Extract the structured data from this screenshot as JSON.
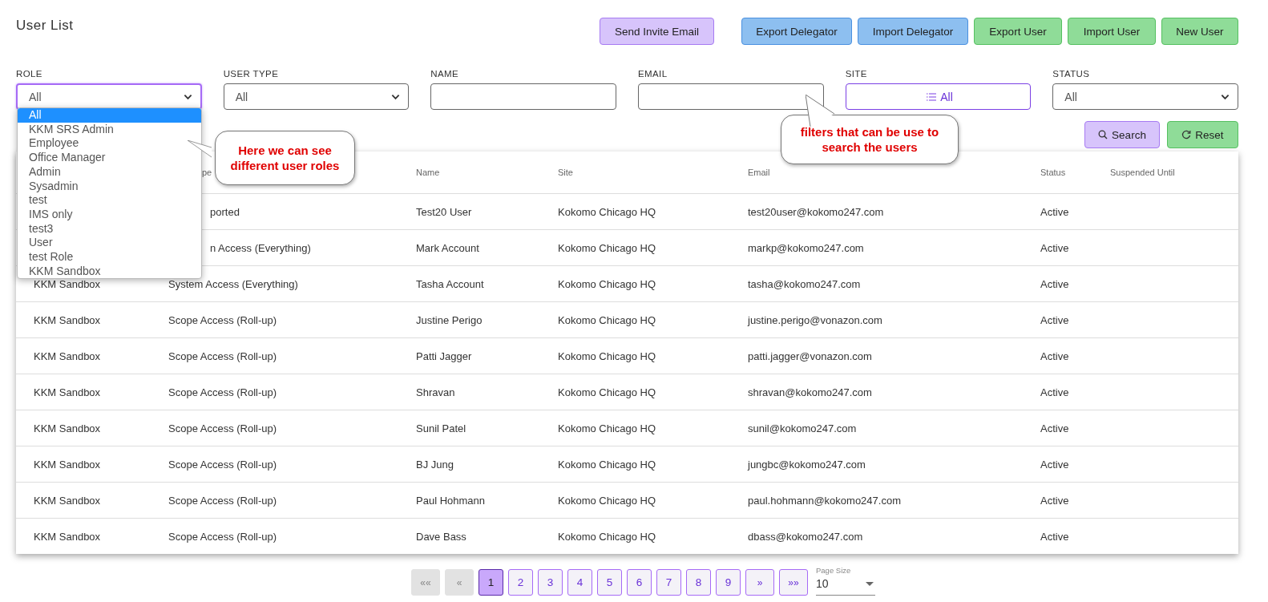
{
  "title": "User List",
  "top_buttons": [
    {
      "label": "Send Invite Email",
      "kind": "invite"
    },
    {
      "label": "Export Delegator",
      "kind": "delegator"
    },
    {
      "label": "Import Delegator",
      "kind": "delegator"
    },
    {
      "label": "Export User",
      "kind": "user"
    },
    {
      "label": "Import User",
      "kind": "user"
    },
    {
      "label": "New User",
      "kind": "user"
    }
  ],
  "filters": [
    {
      "label": "ROLE",
      "kind": "select",
      "value": "All",
      "focused": true
    },
    {
      "label": "USER TYPE",
      "kind": "select",
      "value": "All",
      "focused": false
    },
    {
      "label": "NAME",
      "kind": "text",
      "focused": false
    },
    {
      "label": "EMAIL",
      "kind": "text",
      "focused": false
    },
    {
      "label": "SITE",
      "kind": "multiselect",
      "value": "All",
      "focused": false
    },
    {
      "label": "STATUS",
      "kind": "select",
      "value": "All",
      "focused": false
    }
  ],
  "role_options": [
    {
      "label": "All",
      "selected": true
    },
    {
      "label": "KKM SRS Admin",
      "selected": false
    },
    {
      "label": "Employee",
      "selected": false
    },
    {
      "label": "Office Manager",
      "selected": false
    },
    {
      "label": "Admin",
      "selected": false
    },
    {
      "label": "Sysadmin",
      "selected": false
    },
    {
      "label": "test",
      "selected": false
    },
    {
      "label": "IMS only",
      "selected": false
    },
    {
      "label": "test3",
      "selected": false
    },
    {
      "label": "User",
      "selected": false
    },
    {
      "label": "test Role",
      "selected": false
    },
    {
      "label": "KKM Sandbox",
      "selected": false
    }
  ],
  "search_button": "Search",
  "reset_button": "Reset",
  "callouts": [
    {
      "text": "Here we can see different user roles"
    },
    {
      "text": "filters that can be use to search the users"
    }
  ],
  "table": {
    "header": {
      "user_type": "pe",
      "user_type_cut": true,
      "name": "Name",
      "site": "Site",
      "email": "Email",
      "status": "Status",
      "suspended": "Suspended Until"
    },
    "rows": [
      {
        "user_type": "ported",
        "user_type_cut": true,
        "name": "Test20 User",
        "site": "Kokomo Chicago HQ",
        "email": "test20user@kokomo247.com",
        "status": "Active"
      },
      {
        "user_type": "n Access (Everything)",
        "user_type_cut": true,
        "name": "Mark Account",
        "site": "Kokomo Chicago HQ",
        "email": "markp@kokomo247.com",
        "status": "Active"
      },
      {
        "role": "KKM Sandbox",
        "user_type": "System Access (Everything)",
        "name": "Tasha Account",
        "site": "Kokomo Chicago HQ",
        "email": "tasha@kokomo247.com",
        "status": "Active"
      },
      {
        "role": "KKM Sandbox",
        "user_type": "Scope Access (Roll-up)",
        "name": "Justine Perigo",
        "site": "Kokomo Chicago HQ",
        "email": "justine.perigo@vonazon.com",
        "status": "Active"
      },
      {
        "role": "KKM Sandbox",
        "user_type": "Scope Access (Roll-up)",
        "name": "Patti Jagger",
        "site": "Kokomo Chicago HQ",
        "email": "patti.jagger@vonazon.com",
        "status": "Active"
      },
      {
        "role": "KKM Sandbox",
        "user_type": "Scope Access (Roll-up)",
        "name": "Shravan",
        "site": "Kokomo Chicago HQ",
        "email": "shravan@kokomo247.com",
        "status": "Active"
      },
      {
        "role": "KKM Sandbox",
        "user_type": "Scope Access (Roll-up)",
        "name": "Sunil Patel",
        "site": "Kokomo Chicago HQ",
        "email": "sunil@kokomo247.com",
        "status": "Active"
      },
      {
        "role": "KKM Sandbox",
        "user_type": "Scope Access (Roll-up)",
        "name": "BJ Jung",
        "site": "Kokomo Chicago HQ",
        "email": "jungbc@kokomo247.com",
        "status": "Active"
      },
      {
        "role": "KKM Sandbox",
        "user_type": "Scope Access (Roll-up)",
        "name": "Paul Hohmann",
        "site": "Kokomo Chicago HQ",
        "email": "paul.hohmann@kokomo247.com",
        "status": "Active"
      },
      {
        "role": "KKM Sandbox",
        "user_type": "Scope Access (Roll-up)",
        "name": "Dave Bass",
        "site": "Kokomo Chicago HQ",
        "email": "dbass@kokomo247.com",
        "status": "Active"
      }
    ]
  },
  "pagination": [
    {
      "label": "««",
      "kind": "first",
      "disabled": true,
      "selected": false
    },
    {
      "label": "«",
      "kind": "prev",
      "disabled": true,
      "selected": false
    },
    {
      "label": "1",
      "kind": "page",
      "disabled": false,
      "selected": true
    },
    {
      "label": "2",
      "kind": "page",
      "disabled": false,
      "selected": false
    },
    {
      "label": "3",
      "kind": "page",
      "disabled": false,
      "selected": false
    },
    {
      "label": "4",
      "kind": "page",
      "disabled": false,
      "selected": false
    },
    {
      "label": "5",
      "kind": "page",
      "disabled": false,
      "selected": false
    },
    {
      "label": "6",
      "kind": "page",
      "disabled": false,
      "selected": false
    },
    {
      "label": "7",
      "kind": "page",
      "disabled": false,
      "selected": false
    },
    {
      "label": "8",
      "kind": "page",
      "disabled": false,
      "selected": false
    },
    {
      "label": "9",
      "kind": "page",
      "disabled": false,
      "selected": false
    },
    {
      "label": "»",
      "kind": "next",
      "disabled": false,
      "selected": false
    },
    {
      "label": "»»",
      "kind": "last",
      "disabled": false,
      "selected": false
    }
  ],
  "page_size": {
    "label": "Page Size",
    "value": "10"
  }
}
